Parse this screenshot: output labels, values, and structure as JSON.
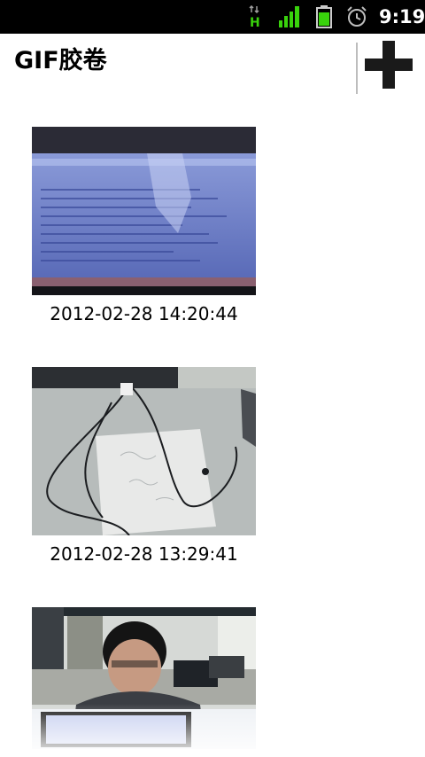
{
  "status_bar": {
    "network_type": "H",
    "time": "9:19",
    "icons": [
      "data-activity-icon",
      "signal-strength-icon",
      "battery-icon",
      "alarm-clock-icon"
    ],
    "accent_color": "#39d20c"
  },
  "app_bar": {
    "title": "GIF胶卷",
    "action_icon": "plus-icon"
  },
  "gif_list": {
    "items": [
      {
        "date": "2012-02-28 14:20:44"
      },
      {
        "date": "2012-02-28 13:29:41"
      },
      {
        "date": ""
      }
    ]
  }
}
